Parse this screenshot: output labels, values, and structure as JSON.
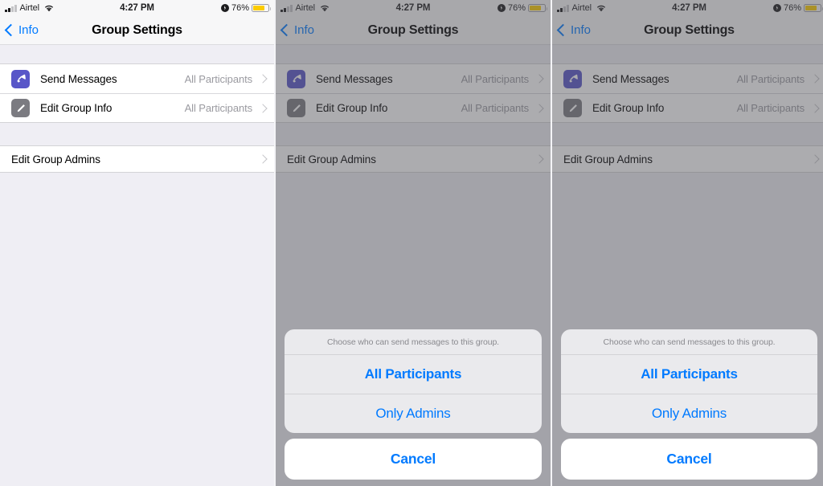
{
  "status_bar": {
    "carrier": "Airtel",
    "time": "4:27 PM",
    "battery_percent": "76%",
    "wifi_icon": "wifi-icon",
    "low_power_icon": "low-power-icon",
    "battery_icon": "battery-icon",
    "battery_color": "#fccc00",
    "battery_level": 76
  },
  "nav": {
    "back_label": "Info",
    "title": "Group Settings",
    "accent_color": "#007aff"
  },
  "settings": {
    "rows": [
      {
        "title": "Send Messages",
        "detail": "All Participants",
        "icon": "megaphone-icon",
        "icon_color": "#5856c8"
      },
      {
        "title": "Edit Group Info",
        "detail": "All Participants",
        "icon": "pencil-icon",
        "icon_color": "#7b7b81"
      }
    ],
    "admins_row": {
      "title": "Edit Group Admins"
    }
  },
  "action_sheet": {
    "title": "Choose who can send messages to this group.",
    "options": [
      {
        "label": "All Participants",
        "selected": true
      },
      {
        "label": "Only Admins",
        "selected": false
      }
    ],
    "cancel_label": "Cancel"
  },
  "panels": [
    {
      "name": "group-settings-plain",
      "sheet_visible": false
    },
    {
      "name": "group-settings-sheet-a",
      "sheet_visible": true
    },
    {
      "name": "group-settings-sheet-b",
      "sheet_visible": true
    }
  ]
}
